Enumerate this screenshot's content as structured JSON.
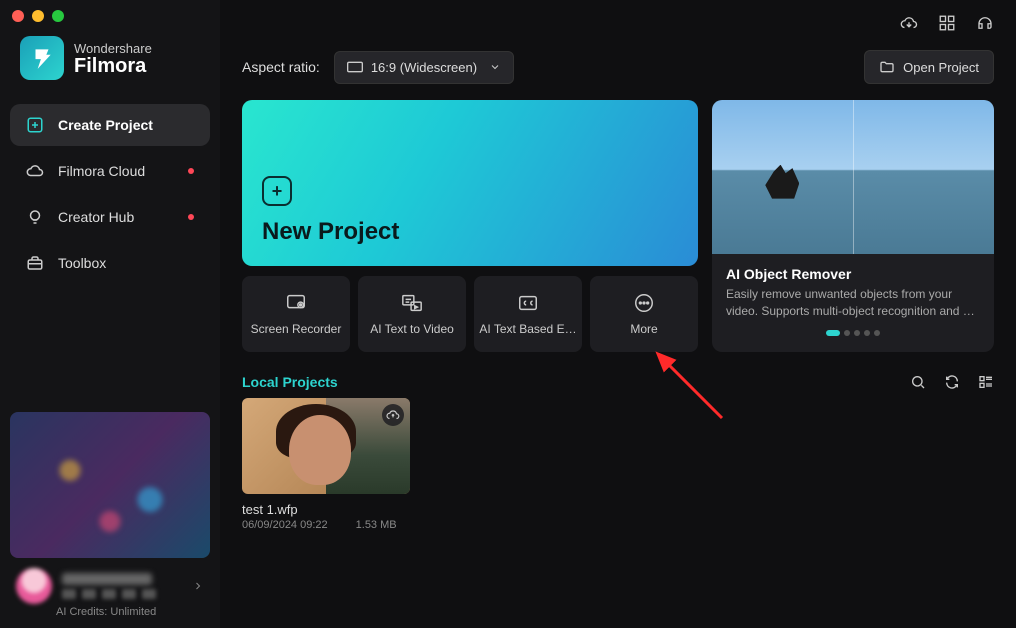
{
  "brand": {
    "line1": "Wondershare",
    "line2": "Filmora"
  },
  "sidebar": {
    "items": [
      {
        "label": "Create Project",
        "icon": "plus-square-icon",
        "active": true,
        "dot": false
      },
      {
        "label": "Filmora Cloud",
        "icon": "cloud-icon",
        "active": false,
        "dot": true
      },
      {
        "label": "Creator Hub",
        "icon": "bulb-icon",
        "active": false,
        "dot": true
      },
      {
        "label": "Toolbox",
        "icon": "toolbox-icon",
        "active": false,
        "dot": false
      }
    ],
    "credits": "AI Credits: Unlimited"
  },
  "topbar": {
    "icons": [
      "cloud-download-icon",
      "grid-icon",
      "headset-icon"
    ]
  },
  "aspect": {
    "label": "Aspect ratio:",
    "selected": "16:9 (Widescreen)"
  },
  "open_project": "Open Project",
  "new_project": {
    "label": "New Project"
  },
  "tools": [
    {
      "label": "Screen Recorder",
      "icon": "screen-record-icon"
    },
    {
      "label": "AI Text to Video",
      "icon": "text-video-icon"
    },
    {
      "label": "AI Text Based E…",
      "icon": "cc-icon"
    },
    {
      "label": "More",
      "icon": "more-icon"
    }
  ],
  "feature": {
    "title": "AI Object Remover",
    "desc": "Easily remove unwanted objects from your video. Supports multi-object recognition and …",
    "page_count": 5,
    "active_page": 0
  },
  "local": {
    "title": "Local Projects",
    "projects": [
      {
        "name": "test 1.wfp",
        "date": "06/09/2024 09:22",
        "size": "1.53 MB"
      }
    ]
  }
}
